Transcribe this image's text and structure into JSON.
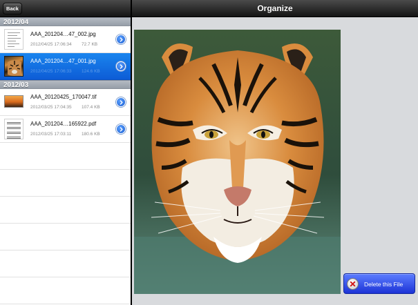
{
  "left_header": {
    "back_label": "Back"
  },
  "sections": [
    {
      "title": "2012/04",
      "files": [
        {
          "name": "AAA_201204…47_002.jpg",
          "date": "2012/04/25 17:06:34",
          "size": "72.7 KB",
          "thumb": "document",
          "selected": false
        },
        {
          "name": "AAA_201204…47_001.jpg",
          "date": "2012/04/25 17:06:33",
          "size": "124.6 KB",
          "thumb": "tiger",
          "selected": true
        }
      ]
    },
    {
      "title": "2012/03",
      "files": [
        {
          "name": "AAA_20120425_170047.tif",
          "date": "2012/03/25 17:04:35",
          "size": "107.4 KB",
          "thumb": "landscape",
          "selected": false
        },
        {
          "name": "AAA_201204…165922.pdf",
          "date": "2012/03/25 17:03:11",
          "size": "180.6 KB",
          "thumb": "sheet-music",
          "selected": false
        }
      ]
    }
  ],
  "right_header": {
    "title": "Organize"
  },
  "actions": {
    "delete_label": "Delete this File"
  },
  "colors": {
    "selection": "#1a85ee",
    "delete_button": "#2f49e8",
    "section_header": "#a3aab3",
    "toolbar": "#2a2a2a"
  },
  "icons": {
    "disclosure": "chevron-right-circle-icon",
    "delete": "x-circle-icon"
  }
}
